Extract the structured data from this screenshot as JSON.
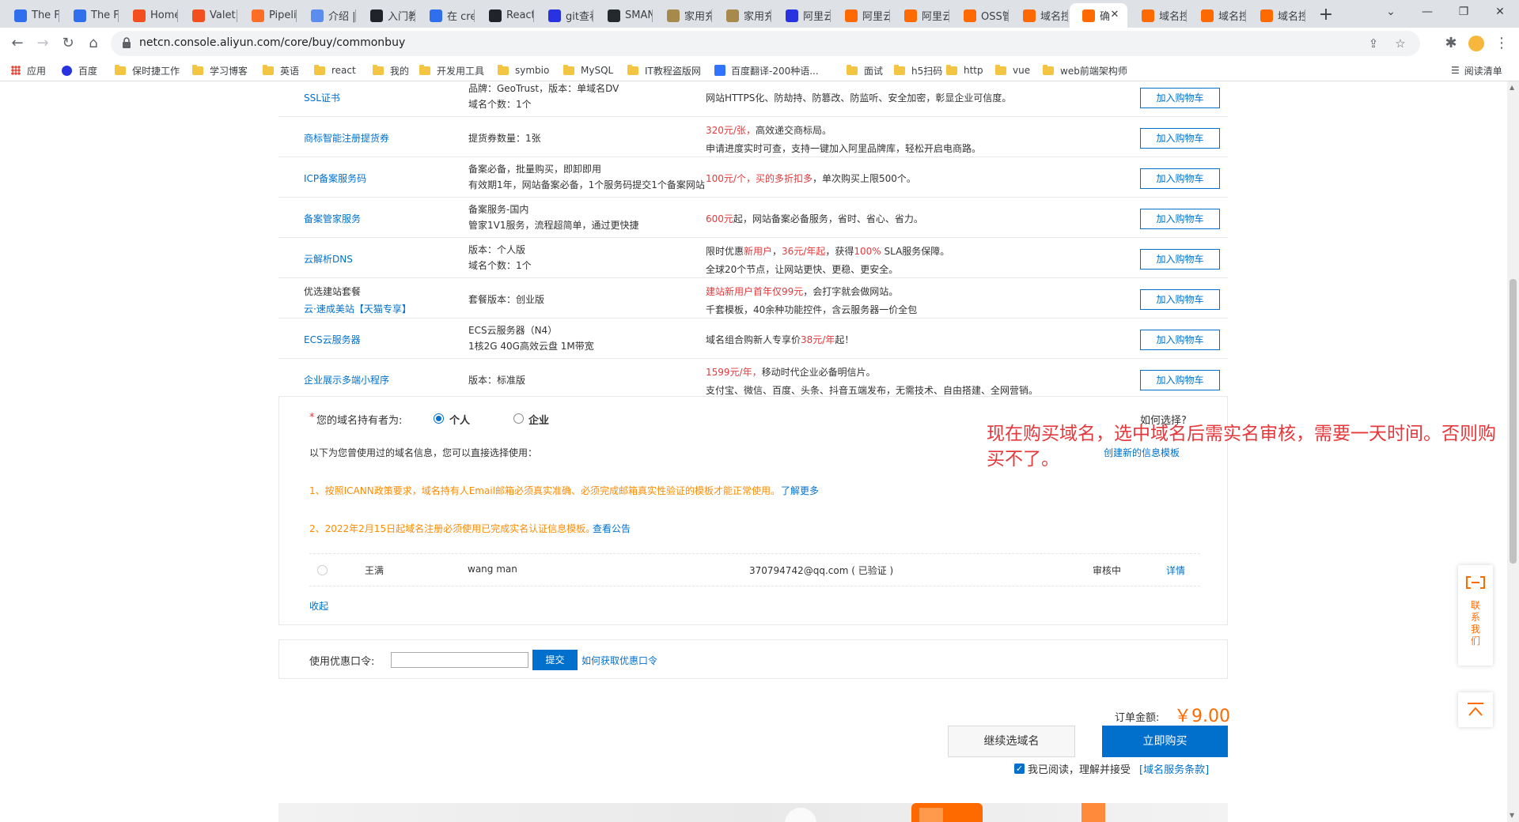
{
  "browser": {
    "tabs": [
      {
        "label": "The Fl",
        "icon": "diamond-icon",
        "color": "#2f6fed"
      },
      {
        "label": "The Fl",
        "icon": "diamond-icon",
        "color": "#2f6fed"
      },
      {
        "label": "Home",
        "icon": "figma-icon",
        "color": "#f24e1e"
      },
      {
        "label": "Valet",
        "icon": "figma-icon",
        "color": "#f24e1e"
      },
      {
        "label": "Pipelin",
        "icon": "gitlab-icon",
        "color": "#fc6d26"
      },
      {
        "label": "介绍 |",
        "icon": "circle-icon",
        "color": "#5b8def"
      },
      {
        "label": "入门教",
        "icon": "react-icon",
        "color": "#20232a"
      },
      {
        "label": "在 cre",
        "icon": "diamond-icon",
        "color": "#2f6fed"
      },
      {
        "label": "React",
        "icon": "react-icon",
        "color": "#20232a"
      },
      {
        "label": "git查看",
        "icon": "paw-icon",
        "color": "#2932e1"
      },
      {
        "label": "SMAN",
        "icon": "github-icon",
        "color": "#24292e"
      },
      {
        "label": "家用充",
        "icon": "porsche-icon",
        "color": "#a58a4b"
      },
      {
        "label": "家用充",
        "icon": "porsche-icon",
        "color": "#a58a4b"
      },
      {
        "label": "阿里云",
        "icon": "paw-icon",
        "color": "#2932e1"
      },
      {
        "label": "阿里云",
        "icon": "aliyun-icon",
        "color": "#ff6a00"
      },
      {
        "label": "阿里云",
        "icon": "aliyun-icon",
        "color": "#ff6a00"
      },
      {
        "label": "OSS管",
        "icon": "aliyun-icon",
        "color": "#ff6a00"
      },
      {
        "label": "域名控",
        "icon": "aliyun-icon",
        "color": "#ff6a00"
      },
      {
        "label": "确",
        "icon": "aliyun-icon",
        "color": "#ff6a00",
        "active": true
      },
      {
        "label": "域名控",
        "icon": "aliyun-icon",
        "color": "#ff6a00"
      },
      {
        "label": "域名控",
        "icon": "aliyun-icon",
        "color": "#ff6a00"
      },
      {
        "label": "域名控",
        "icon": "aliyun-icon",
        "color": "#ff6a00"
      }
    ],
    "url": "netcn.console.aliyun.com/core/buy/commonbuy",
    "bookmarks": [
      {
        "label": "应用",
        "icon": "apps-grid-icon"
      },
      {
        "label": "百度",
        "icon": "paw-icon"
      },
      {
        "label": "保时捷工作",
        "icon": "folder-icon"
      },
      {
        "label": "学习博客",
        "icon": "folder-icon"
      },
      {
        "label": "英语",
        "icon": "folder-icon"
      },
      {
        "label": "react",
        "icon": "folder-icon"
      },
      {
        "label": "我的",
        "icon": "folder-icon"
      },
      {
        "label": "开发用工具",
        "icon": "folder-icon"
      },
      {
        "label": "symbio",
        "icon": "folder-icon"
      },
      {
        "label": "MySQL",
        "icon": "folder-icon"
      },
      {
        "label": "IT教程盗版网",
        "icon": "folder-icon"
      },
      {
        "label": "百度翻译-200种语...",
        "icon": "translate-icon"
      },
      {
        "label": "面试",
        "icon": "folder-icon"
      },
      {
        "label": "h5扫码",
        "icon": "folder-icon"
      },
      {
        "label": "http",
        "icon": "folder-icon"
      },
      {
        "label": "vue",
        "icon": "folder-icon"
      },
      {
        "label": "web前端架构师",
        "icon": "folder-icon"
      }
    ],
    "reading_list": "阅读清单"
  },
  "products": [
    {
      "name": "SSL证书",
      "spec": [
        "品牌：GeoTrust，版本：单域名DV",
        "域名个数：1个"
      ],
      "desc": [
        [
          {
            "t": "网站HTTPS化、防劫持、防篡改、防监听、安全加密，彰显企业可信度。"
          }
        ]
      ],
      "name_black": false
    },
    {
      "name": "商标智能注册提货券",
      "spec": [
        "提货券数量：1张"
      ],
      "desc": [
        [
          {
            "t": "320元/张，",
            "red": true
          },
          {
            "t": "高效递交商标局。"
          }
        ],
        [
          {
            "t": "申请进度实时可查，支持一键加入阿里品牌库，轻松开启电商路。"
          }
        ]
      ],
      "name_black": false
    },
    {
      "name": "ICP备案服务码",
      "spec": [
        "备案必备，批量购买，即卸即用",
        "有效期1年，网站备案必备，1个服务码提交1个备案网站"
      ],
      "desc": [
        [
          {
            "t": "100元/个，",
            "red": true
          },
          {
            "t": "买的多折扣多",
            "red": true
          },
          {
            "t": "，单次购买上限500个。"
          }
        ]
      ],
      "name_black": false
    },
    {
      "name": "备案管家服务",
      "spec": [
        "备案服务-国内",
        "管家1V1服务，流程超简单，通过更快捷"
      ],
      "desc": [
        [
          {
            "t": "600元",
            "red": true
          },
          {
            "t": "起，网站备案必备服务，省时、省心、省力。"
          }
        ]
      ],
      "name_black": false
    },
    {
      "name": "云解析DNS",
      "spec": [
        "版本：个人版",
        "域名个数：1个"
      ],
      "desc": [
        [
          {
            "t": "限时优惠"
          },
          {
            "t": "新用户",
            "red": true
          },
          {
            "t": "，"
          },
          {
            "t": "36元/年起",
            "red": true
          },
          {
            "t": "，获得"
          },
          {
            "t": "100%",
            "red": true
          },
          {
            "t": " SLA服务保障。"
          }
        ],
        [
          {
            "t": "全球20个节点，让网站更快、更稳、更安全。"
          }
        ]
      ],
      "name_black": false
    },
    {
      "name": "优选建站套餐",
      "name2": "云·速成美站【天猫专享】",
      "spec": [
        "套餐版本：创业版"
      ],
      "desc": [
        [
          {
            "t": "建站新用户首年仅99元",
            "red": true
          },
          {
            "t": "，会打字就会做网站。"
          }
        ],
        [
          {
            "t": "千套模板，40余种功能控件，含云服务器一价全包"
          }
        ]
      ],
      "name_black": true
    },
    {
      "name": "ECS云服务器",
      "spec": [
        "ECS云服务器（N4）",
        "1核2G 40G高效云盘 1M带宽"
      ],
      "desc": [
        [
          {
            "t": "域名组合购新人专享价"
          },
          {
            "t": "38元/年",
            "red": true
          },
          {
            "t": "起！"
          }
        ]
      ],
      "name_black": false
    },
    {
      "name": "企业展示多端小程序",
      "spec": [
        "版本：标准版"
      ],
      "desc": [
        [
          {
            "t": "1599元/年，",
            "red": true
          },
          {
            "t": "移动时代企业必备明信片。"
          }
        ],
        [
          {
            "t": "支付宝、微信、百度、头条、抖音五端发布，无需技术、自由搭建、全网营销。"
          }
        ]
      ],
      "name_black": false
    }
  ],
  "add_to_cart": "加入购物车",
  "owner": {
    "required_mark": "*",
    "label": "您的域名持有者为:",
    "options": [
      {
        "label": "个人",
        "selected": true
      },
      {
        "label": "企业",
        "selected": false
      }
    ],
    "how_to_choose": "如何选择?",
    "history_hint": "以下为您曾使用过的域名信息，您可以直接选择使用：",
    "create_template": "创建新的信息模板",
    "notice1": "1、按照ICANN政策要求，域名持有人Email邮箱必须真实准确、必须完成邮箱真实性验证的模板才能正常使用。",
    "notice1_link": "了解更多",
    "notice2": "2、2022年2月15日起域名注册必须使用已完成实名认证信息模板。",
    "notice2_link": "查看公告",
    "record": {
      "name_cn": "王满",
      "name_en": "wang man",
      "email": "370794742@qq.com ( 已验证 )",
      "status": "审核中",
      "detail": "详情"
    },
    "collapse": "收起"
  },
  "coupon": {
    "label": "使用优惠口令:",
    "value": "",
    "submit": "提交",
    "how_to": "如何获取优惠口令"
  },
  "order": {
    "amount_label": "订单金额:",
    "amount": "￥9.00",
    "continue": "继续选域名",
    "buy_now": "立即购买",
    "agree_text": "我已阅读，理解并接受",
    "terms_link": "[域名服务条款]",
    "agreed": true
  },
  "annotation": "现在购买域名，选中域名后需实名审核，需要一天时间。否则购买不了。",
  "float": {
    "contact": [
      "联",
      "系",
      "我",
      "们"
    ]
  },
  "colors": {
    "link": "#0070cc",
    "price": "#ff6a00",
    "accent_red": "#e4393c",
    "notice_orange": "#ff8a00"
  }
}
